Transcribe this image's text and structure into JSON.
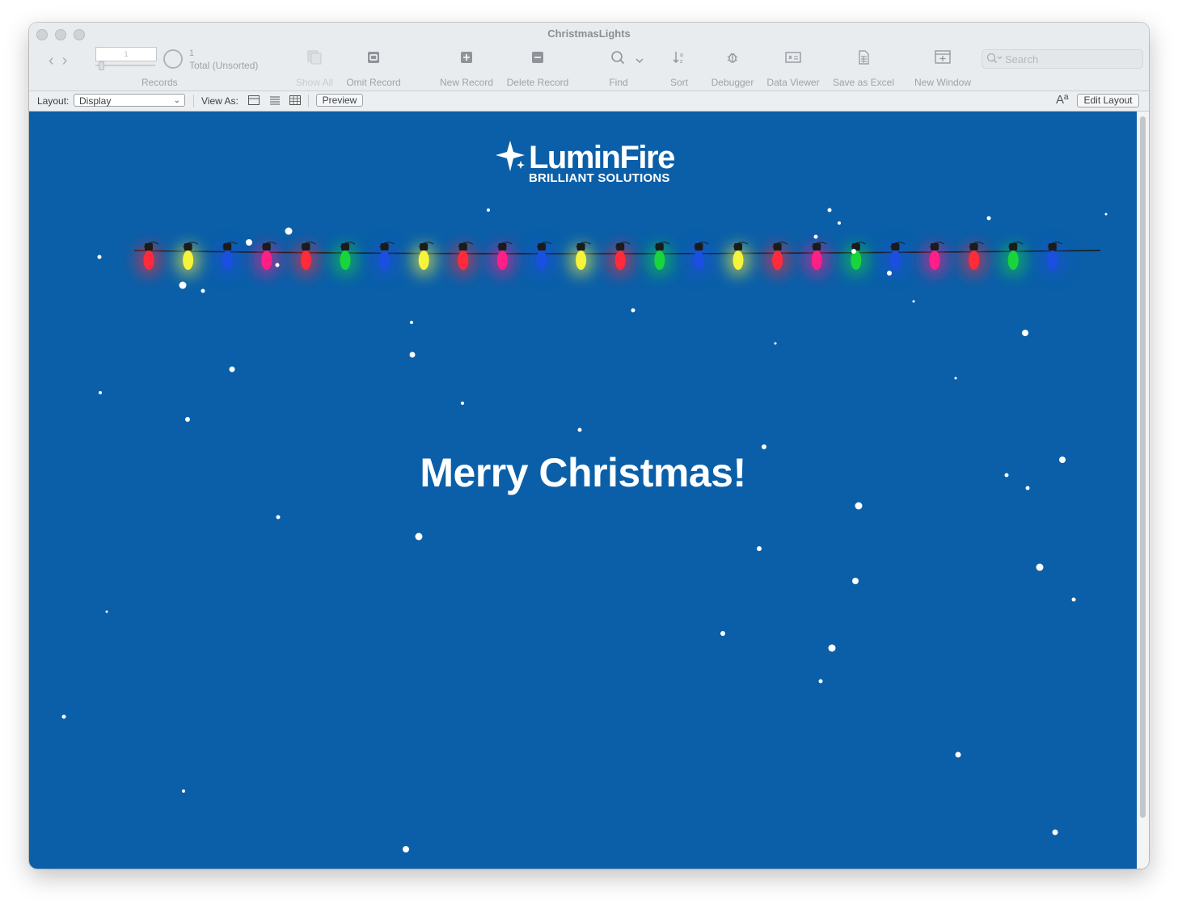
{
  "window": {
    "title": "ChristmasLights"
  },
  "records": {
    "current": "1",
    "found": "1",
    "total_label": "Total (Unsorted)",
    "label": "Records"
  },
  "toolbar": {
    "show_all": "Show All",
    "omit_record": "Omit Record",
    "new_record": "New Record",
    "delete_record": "Delete Record",
    "find": "Find",
    "sort": "Sort",
    "debugger": "Debugger",
    "data_viewer": "Data Viewer",
    "save_as_excel": "Save as Excel",
    "new_window": "New Window",
    "search_placeholder": "Search"
  },
  "layout_bar": {
    "layout_label": "Layout:",
    "layout_value": "Display",
    "view_as_label": "View As:",
    "preview_label": "Preview",
    "format_glyph": "Aª",
    "edit_layout_label": "Edit Layout"
  },
  "content": {
    "background": "#0a5fa8",
    "logo_brand": "LuminFire",
    "logo_tagline": "BRILLIANT SOLUTIONS",
    "greeting": "Merry Christmas!",
    "light_colors": [
      "red",
      "yellow",
      "blue",
      "magenta",
      "red",
      "green",
      "blue",
      "yellow",
      "red",
      "magenta",
      "blue",
      "yellow",
      "red",
      "green",
      "blue",
      "yellow",
      "red",
      "magenta",
      "green",
      "blue",
      "magenta",
      "red",
      "green",
      "blue"
    ],
    "palette": {
      "red": "#ff2b3a",
      "yellow": "#f6f43a",
      "blue": "#1b4fe0",
      "magenta": "#ff1f86",
      "green": "#19d43c"
    }
  }
}
